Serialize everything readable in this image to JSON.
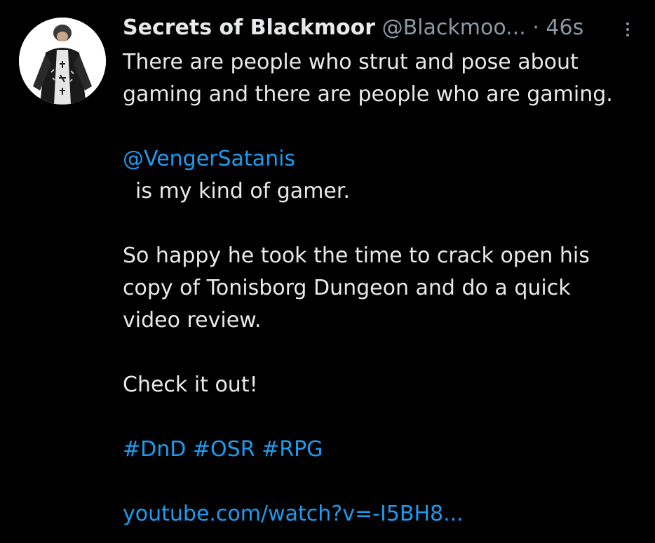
{
  "tweet": {
    "display_name": "Secrets of Blackmoor",
    "handle": "@Blackmoo...",
    "separator": "·",
    "time": "46s",
    "avatar_icon": "avatar-hooded-figure",
    "more_icon": "more-options-vertical-dots",
    "text": {
      "line1": "There are people who strut and pose about",
      "line2": "gaming and there are people who are gaming.",
      "mention": "@VengerSatanis",
      "line3": "is my kind of gamer.",
      "line4": "So happy he took the time to crack open his",
      "line5": "copy of Tonisborg Dungeon and do a quick",
      "line6": "video review.",
      "line7": "Check it out!",
      "hashtag1": "#DnD",
      "hashtag2": "#OSR",
      "hashtag3": "#RPG",
      "url": "youtube.com/watch?v=-I5BH8..."
    }
  },
  "colors": {
    "background": "#000000",
    "text": "#e7e9ea",
    "secondary": "#8b98a5",
    "link": "#1d9bf0"
  }
}
